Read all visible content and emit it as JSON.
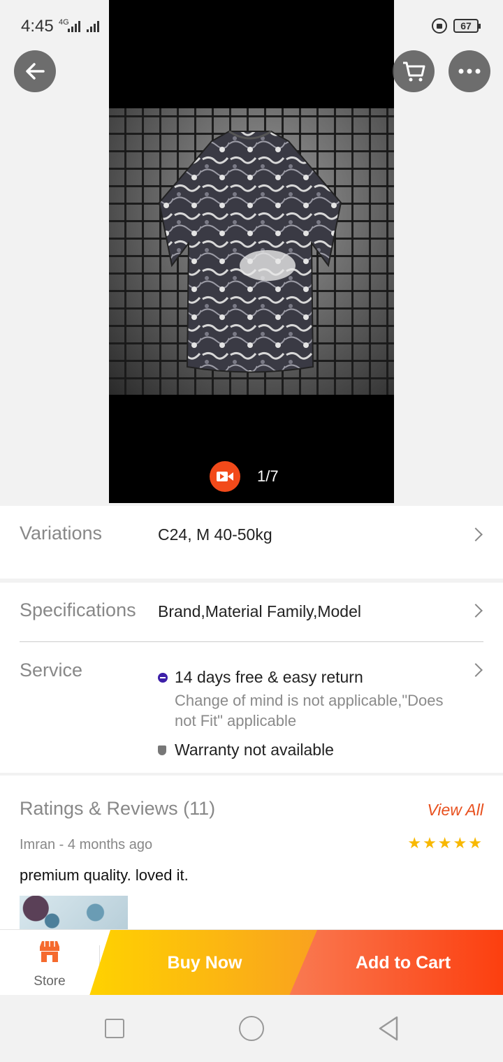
{
  "status_bar": {
    "time": "4:45",
    "network": "4G",
    "battery": "67"
  },
  "gallery": {
    "counter": "1/7",
    "video_icon": "video-icon"
  },
  "top_buttons": {
    "back": "back-arrow-icon",
    "cart": "cart-icon",
    "more": "more-icon"
  },
  "variations": {
    "label": "Variations",
    "value": "C24, M 40-50kg"
  },
  "specifications": {
    "label": "Specifications",
    "value": "Brand,Material Family,Model"
  },
  "service": {
    "label": "Service",
    "return_title": "14 days free & easy return",
    "return_note_line1": "Change of mind is not applicable,\"Does",
    "return_note_line2": "not Fit\" applicable",
    "warranty": "Warranty not available"
  },
  "ratings": {
    "title": "Ratings & Reviews (11)",
    "view_all": "View All",
    "review": {
      "author_line": "Imran - 4 months ago",
      "stars": 5,
      "text": "premium quality. loved it."
    }
  },
  "action_bar": {
    "store_label": "Store",
    "buy_now": "Buy Now",
    "add_to_cart": "Add to Cart"
  },
  "colors": {
    "accent": "#f24a1a",
    "buy_yellow": "#ffd200",
    "cart_orange": "#fc3f0f",
    "link": "#e8501e"
  }
}
